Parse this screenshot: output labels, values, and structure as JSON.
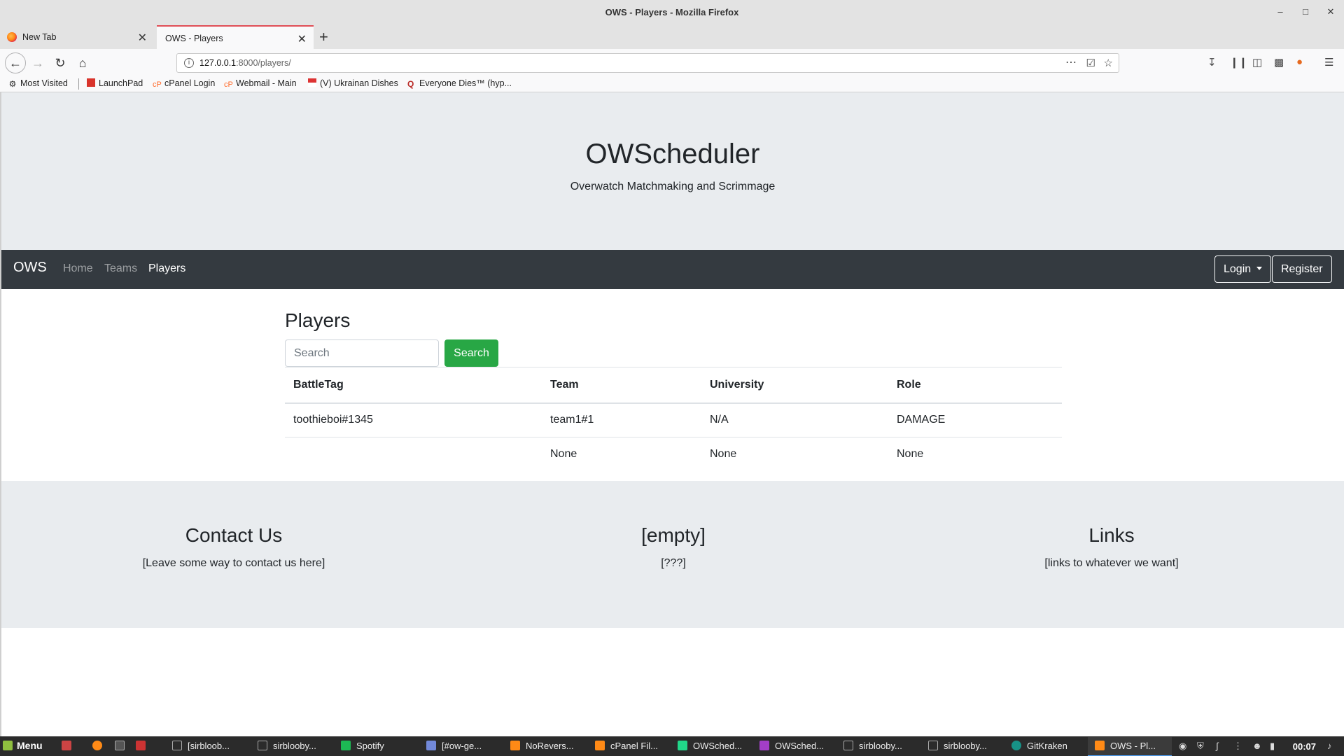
{
  "window": {
    "title": "OWS - Players - Mozilla Firefox"
  },
  "tabs": [
    {
      "label": "New Tab"
    },
    {
      "label": "OWS - Players"
    }
  ],
  "url": {
    "host": "127.0.0.1",
    "rest": ":8000/players/"
  },
  "bookmarks": [
    {
      "label": "Most Visited"
    },
    {
      "label": "LaunchPad"
    },
    {
      "label": "cPanel Login"
    },
    {
      "label": "Webmail - Main"
    },
    {
      "label": "(V) Ukrainan Dishes"
    },
    {
      "label": "Everyone Dies™ (hyp..."
    }
  ],
  "site": {
    "title": "OWScheduler",
    "subtitle": "Overwatch Matchmaking and Scrimmage",
    "nav": {
      "brand": "OWS",
      "links": [
        {
          "label": "Home"
        },
        {
          "label": "Teams"
        },
        {
          "label": "Players"
        }
      ],
      "login": "Login",
      "register": "Register"
    }
  },
  "players": {
    "heading": "Players",
    "search_placeholder": "Search",
    "search_button": "Search",
    "columns": [
      "BattleTag",
      "Team",
      "University",
      "Role"
    ],
    "rows": [
      [
        "toothieboi#1345",
        "team1#1",
        "N/A",
        "DAMAGE"
      ],
      [
        "",
        "None",
        "None",
        "None"
      ]
    ]
  },
  "footer": [
    {
      "heading": "Contact Us",
      "text": "[Leave some way to contact us here]"
    },
    {
      "heading": "[empty]",
      "text": "[???]"
    },
    {
      "heading": "Links",
      "text": "[links to whatever we want]"
    }
  ],
  "taskbar": {
    "menu": "Menu",
    "items": [
      {
        "label": "[sirbloob..."
      },
      {
        "label": "sirblooby..."
      },
      {
        "label": "Spotify"
      },
      {
        "label": "[#ow-ge..."
      },
      {
        "label": "NoRevers..."
      },
      {
        "label": "cPanel Fil..."
      },
      {
        "label": "OWSched..."
      },
      {
        "label": "OWSched..."
      },
      {
        "label": "sirblooby..."
      },
      {
        "label": "sirblooby..."
      },
      {
        "label": "GitKraken"
      },
      {
        "label": "OWS - Pl..."
      }
    ],
    "clock": "00:07"
  }
}
